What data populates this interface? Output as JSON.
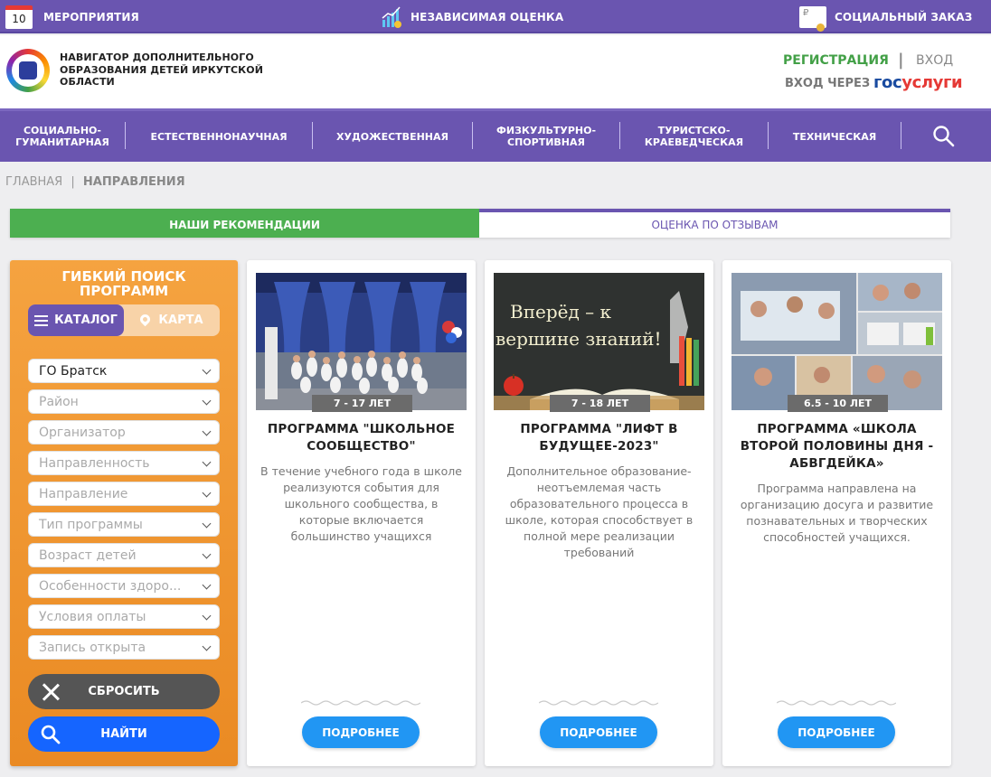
{
  "topbar": {
    "events_day": "10",
    "events_label": "МЕРОПРИЯТИЯ",
    "eval_label": "НЕЗАВИСИМАЯ ОЦЕНКА",
    "order_label": "СОЦИАЛЬНЫЙ ЗАКАЗ"
  },
  "header": {
    "org_title": "НАВИГАТОР ДОПОЛНИТЕЛЬНОГО ОБРАЗОВАНИЯ ДЕТЕЙ ИРКУТСКОЙ ОБЛАСТИ",
    "register": "РЕГИСТРАЦИЯ",
    "separator": "|",
    "login": "ВХОД",
    "login_via": "ВХОД ЧЕРЕЗ",
    "gos_part1": "гос",
    "gos_part2": "услуги"
  },
  "nav": {
    "items": [
      {
        "line1": "СОЦИАЛЬНО-",
        "line2": "ГУМАНИТАРНАЯ"
      },
      {
        "line1": "ЕСТЕСТВЕННОНАУЧНАЯ",
        "line2": ""
      },
      {
        "line1": "ХУДОЖЕСТВЕННАЯ",
        "line2": ""
      },
      {
        "line1": "ФИЗКУЛЬТУРНО-",
        "line2": "СПОРТИВНАЯ"
      },
      {
        "line1": "ТУРИСТСКО-",
        "line2": "КРАЕВЕДЧЕСКАЯ"
      },
      {
        "line1": "ТЕХНИЧЕСКАЯ",
        "line2": ""
      }
    ]
  },
  "breadcrumbs": {
    "home": "ГЛАВНАЯ",
    "separator": "|",
    "current": "НАПРАВЛЕНИЯ"
  },
  "tabs": {
    "recommendations": "НАШИ РЕКОМЕНДАЦИИ",
    "reviews": "ОЦЕНКА ПО ОТЗЫВАМ"
  },
  "filter": {
    "title_line1": "ГИБКИЙ ПОИСК",
    "title_line2": "ПРОГРАММ",
    "catalog_label": "КАТАЛОГ",
    "map_label": "КАРТА",
    "selects": [
      {
        "value": "ГО Братск",
        "active": true
      },
      {
        "value": "Район",
        "active": false
      },
      {
        "value": "Организатор",
        "active": false
      },
      {
        "value": "Направленность",
        "active": false
      },
      {
        "value": "Направление",
        "active": false
      },
      {
        "value": "Тип программы",
        "active": false
      },
      {
        "value": "Возраст детей",
        "active": false
      },
      {
        "value": "Особенности здоро...",
        "active": false
      },
      {
        "value": "Условия оплаты",
        "active": false
      },
      {
        "value": "Запись открыта",
        "active": false
      }
    ],
    "reset_label": "СБРОСИТЬ",
    "find_label": "НАЙТИ"
  },
  "cards": [
    {
      "age": "7 - 17 ЛЕТ",
      "title": "ПРОГРАММА \"ШКОЛЬНОЕ СООБЩЕСТВО\"",
      "description": "В течение учебного года в школе реализуются события для школьного сообщества, в которые включается большинство учащихся",
      "more": "ПОДРОБНЕЕ"
    },
    {
      "age": "7 - 18 ЛЕТ",
      "title": "ПРОГРАММА \"ЛИФТ В БУДУЩЕЕ-2023\"",
      "description": "Дополнительное образование- неотъемлемая часть образовательного процесса в школе, которая способствует в полной мере реализации требований",
      "more": "ПОДРОБНЕЕ",
      "banner_line1": "Вперёд – к",
      "banner_line2": "вершине знаний!"
    },
    {
      "age": "6.5 - 10 ЛЕТ",
      "title": "ПРОГРАММА «ШКОЛА ВТОРОЙ ПОЛОВИНЫ ДНЯ - АБВГДЕЙКА»",
      "description": "Программа направлена на организацию досуга и развитие познавательных и творческих способностей учащихся.",
      "more": "ПОДРОБНЕЕ"
    }
  ],
  "colors": {
    "brand_purple": "#6a55b0",
    "green": "#4caf50",
    "orange": "#f0962f",
    "blue_button": "#2196f3",
    "find_blue": "#1565ff"
  }
}
